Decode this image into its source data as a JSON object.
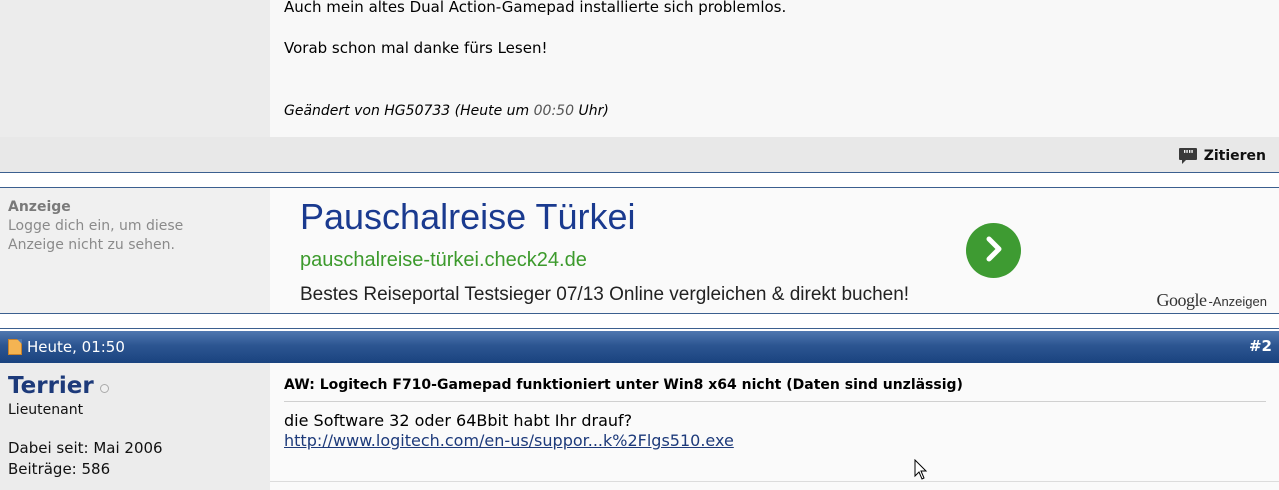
{
  "post1": {
    "lines": [
      "Auch mein altes Dual Action-Gamepad installierte sich problemlos.",
      "Vorab schon mal danke fürs Lesen!"
    ],
    "edited_prefix": "Geändert von HG50733 (Heute um ",
    "edited_time": "00:50",
    "edited_suffix": " Uhr)",
    "quote_label": "Zitieren"
  },
  "ad": {
    "sidebar_heading": "Anzeige",
    "sidebar_text": "Logge dich ein, um diese Anzeige nicht zu sehen.",
    "title": "Pauschalreise Türkei",
    "url": "pauschalreise-türkei.check24.de",
    "description": "Bestes Reiseportal Testsieger 07/13 Online vergleichen & direkt buchen!",
    "google_logo": "Google",
    "google_suffix": "-Anzeigen"
  },
  "post2": {
    "date": "Heute, 01:50",
    "number": "#2",
    "username": "Terrier",
    "rank": "Lieutenant",
    "joined": "Dabei seit: Mai 2006",
    "posts": "Beiträge: 586",
    "title": "AW: Logitech F710-Gamepad funktioniert unter Win8 x64 nicht (Daten sind unzlässig)",
    "body_text": "die Software 32 oder 64Bbit habt Ihr drauf?",
    "link_text": "http://www.logitech.com/en-us/suppor...k%2Flgs510.exe"
  },
  "colors": {
    "header_blue": "#2c5591",
    "username": "#1d3a7a",
    "ad_title": "#1a3a8f",
    "ad_url": "#3c9a2c",
    "ad_button": "#3e9b32"
  },
  "icons": [
    "quote-bubble-icon",
    "chevron-right-icon",
    "document-icon",
    "offline-status-icon",
    "mouse-cursor-icon"
  ]
}
